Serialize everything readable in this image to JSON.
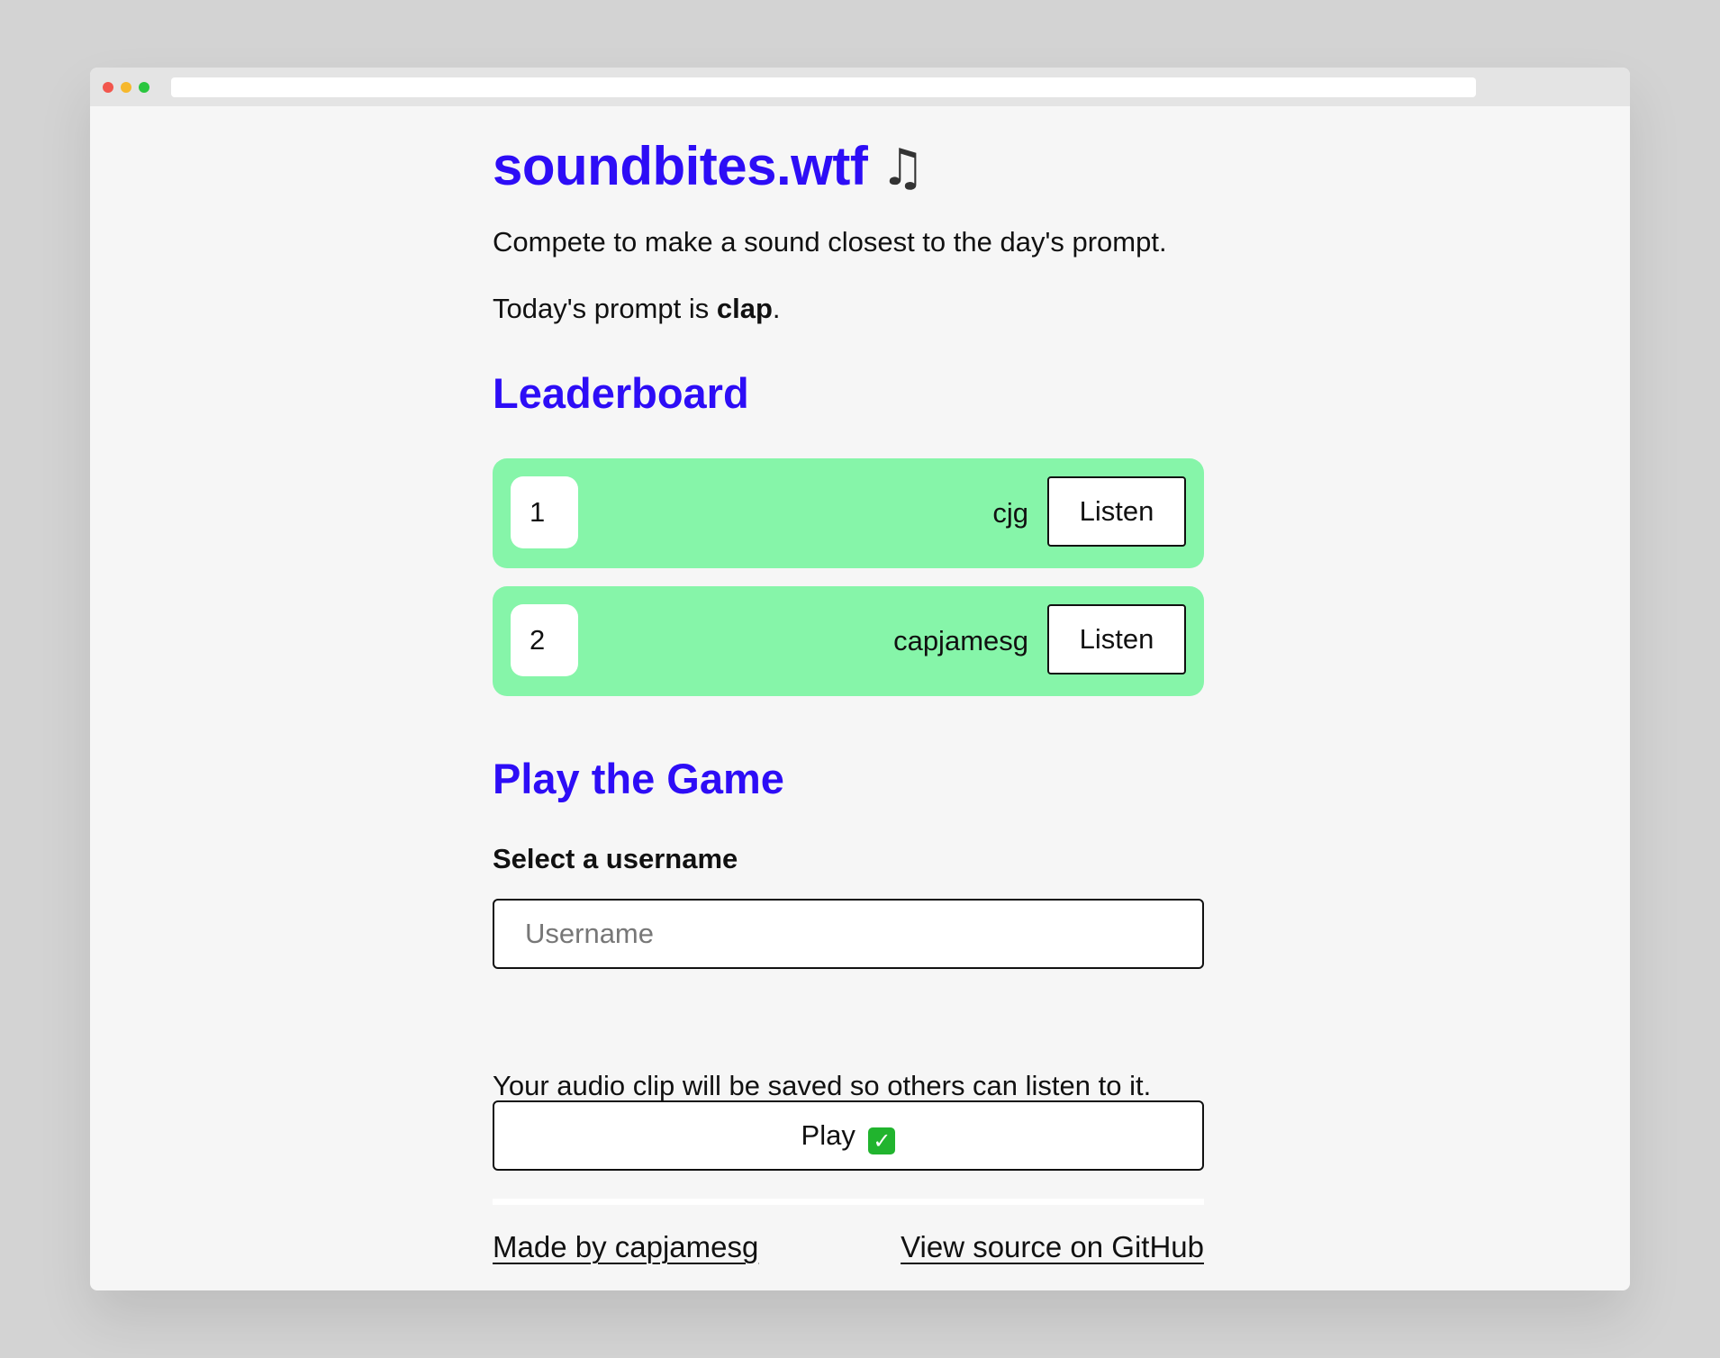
{
  "header": {
    "title": "soundbites.wtf",
    "title_icon": "musical-notes-icon"
  },
  "intro": {
    "tagline": "Compete to make a sound closest to the day's prompt.",
    "prompt_prefix": "Today's prompt is ",
    "prompt_word": "clap",
    "prompt_suffix": "."
  },
  "leaderboard": {
    "title": "Leaderboard",
    "accent_color": "#86f5a9",
    "rows": [
      {
        "rank": "1",
        "user": "cjg",
        "button": "Listen"
      },
      {
        "rank": "2",
        "user": "capjamesg",
        "button": "Listen"
      }
    ]
  },
  "play": {
    "title": "Play the Game",
    "username_label": "Select a username",
    "username_placeholder": "Username",
    "username_value": "",
    "save_note": "Your audio clip will be saved so others can listen to it.",
    "play_button": "Play",
    "play_icon": "check-mark-icon"
  },
  "footer": {
    "left_link": "Made by capjamesg",
    "right_link": "View source on GitHub"
  },
  "colors": {
    "heading": "#2d0df6",
    "leaderboard_row": "#86f5a9",
    "page_background": "#f6f6f6"
  }
}
